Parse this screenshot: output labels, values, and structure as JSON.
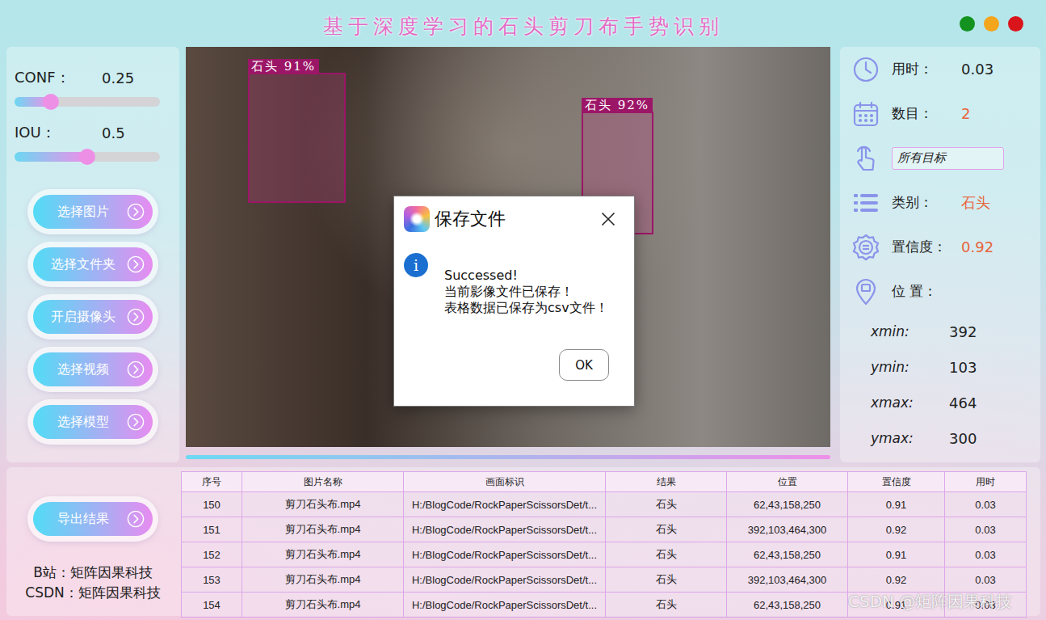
{
  "window": {
    "title": "基于深度学习的石头剪刀布手势识别",
    "controls": [
      {
        "color": "#13921f"
      },
      {
        "color": "#f3a51c"
      },
      {
        "color": "#d9141a"
      }
    ]
  },
  "sliders": [
    {
      "label": "CONF：",
      "value": "0.25",
      "level": 0.25
    },
    {
      "label": "IOU：",
      "value": "0.5",
      "level": 0.5
    }
  ],
  "actions": [
    {
      "label": "选择图片"
    },
    {
      "label": "选择文件夹"
    },
    {
      "label": "开启摄像头"
    },
    {
      "label": "选择视频"
    },
    {
      "label": "选择模型"
    }
  ],
  "video": {
    "detections": [
      {
        "label": "石头 91%"
      },
      {
        "label": "石头 92%"
      }
    ],
    "progress": {
      "level": 1
    }
  },
  "stats": [
    {
      "kind": "value",
      "label": "用时：",
      "value": "0.03",
      "color": "#222222"
    },
    {
      "kind": "value",
      "label": "数目：",
      "value": "2",
      "color": "#e8643c"
    },
    {
      "kind": "select",
      "label": "",
      "value": "所有目标",
      "color": "#222222"
    },
    {
      "kind": "value",
      "label": "类别：",
      "value": "石头",
      "color": "#e8643c"
    },
    {
      "kind": "value",
      "label": "置信度：",
      "value": "0.92",
      "color": "#e8643c"
    },
    {
      "kind": "heading",
      "label": "位 置：",
      "value": "",
      "color": "#222222"
    }
  ],
  "coords": [
    {
      "label": "xmin:",
      "value": "392"
    },
    {
      "label": "ymin:",
      "value": "103"
    },
    {
      "label": "xmax:",
      "value": "464"
    },
    {
      "label": "ymax:",
      "value": "300"
    }
  ],
  "export_button": {
    "label": "导出结果"
  },
  "credits": [
    "B站：矩阵因果科技",
    "CSDN：矩阵因果科技"
  ],
  "table": {
    "columns": [
      "序号",
      "图片名称",
      "画面标识",
      "结果",
      "位置",
      "置信度",
      "用时"
    ],
    "rows": [
      {
        "cells": [
          "150",
          "剪刀石头布.mp4",
          "H:/BlogCode/RockPaperScissorsDet/t...",
          "石头",
          "62,43,158,250",
          "0.91",
          "0.03"
        ]
      },
      {
        "cells": [
          "151",
          "剪刀石头布.mp4",
          "H:/BlogCode/RockPaperScissorsDet/t...",
          "石头",
          "392,103,464,300",
          "0.92",
          "0.03"
        ]
      },
      {
        "cells": [
          "152",
          "剪刀石头布.mp4",
          "H:/BlogCode/RockPaperScissorsDet/t...",
          "石头",
          "62,43,158,250",
          "0.91",
          "0.03"
        ]
      },
      {
        "cells": [
          "153",
          "剪刀石头布.mp4",
          "H:/BlogCode/RockPaperScissorsDet/t...",
          "石头",
          "392,103,464,300",
          "0.92",
          "0.03"
        ]
      },
      {
        "cells": [
          "154",
          "剪刀石头布.mp4",
          "H:/BlogCode/RockPaperScissorsDet/t...",
          "石头",
          "62,43,158,250",
          "0.91",
          "0.03"
        ]
      }
    ]
  },
  "watermark": "CSDN @矩阵因果科技",
  "dialog": {
    "title": "保存文件",
    "info_glyph": "i",
    "lines": [
      "Successed!",
      "当前影像文件已保存！",
      "表格数据已保存为csv文件！"
    ],
    "buttons": [
      "OK"
    ]
  }
}
